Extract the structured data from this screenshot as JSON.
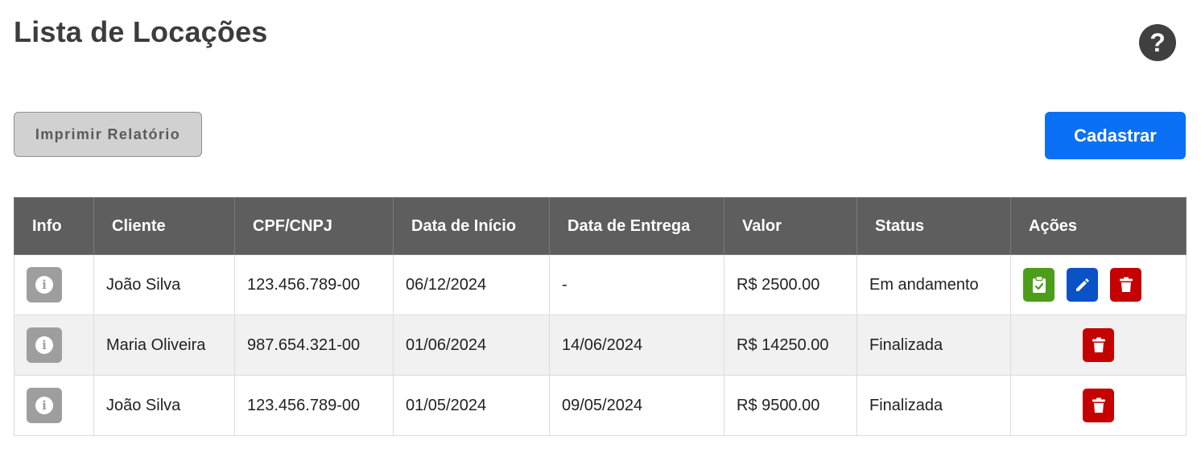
{
  "page": {
    "title": "Lista de Locações",
    "help_icon": "question-circle-icon"
  },
  "toolbar": {
    "print_label": "Imprimir Relatório",
    "add_label": "Cadastrar",
    "add_color": "#0a70f5"
  },
  "table": {
    "headers": [
      "Info",
      "Cliente",
      "CPF/CNPJ",
      "Data de Início",
      "Data de Entrega",
      "Valor",
      "Status",
      "Ações"
    ],
    "rows": [
      {
        "cliente": "João Silva",
        "documento": "123.456.789-00",
        "data_inicio": "06/12/2024",
        "data_entrega": "-",
        "valor": "R$ 2500.00",
        "status": "Em andamento",
        "actions": [
          "finish",
          "edit",
          "delete"
        ]
      },
      {
        "cliente": "Maria Oliveira",
        "documento": "987.654.321-00",
        "data_inicio": "01/06/2024",
        "data_entrega": "14/06/2024",
        "valor": "R$ 14250.00",
        "status": "Finalizada",
        "actions": [
          "delete"
        ]
      },
      {
        "cliente": "João Silva",
        "documento": "123.456.789-00",
        "data_inicio": "01/05/2024",
        "data_entrega": "09/05/2024",
        "valor": "R$ 9500.00",
        "status": "Finalizada",
        "actions": [
          "delete"
        ]
      }
    ]
  },
  "colors": {
    "header_bg": "#5e5e5e",
    "finish_button": "#4c9e1a",
    "edit_button": "#0b52c7",
    "delete_button": "#c40000",
    "info_button": "#9e9e9e"
  },
  "icons": {
    "info": "info-circle-icon",
    "finish": "clipboard-check-icon",
    "edit": "pencil-icon",
    "delete": "trash-icon"
  }
}
